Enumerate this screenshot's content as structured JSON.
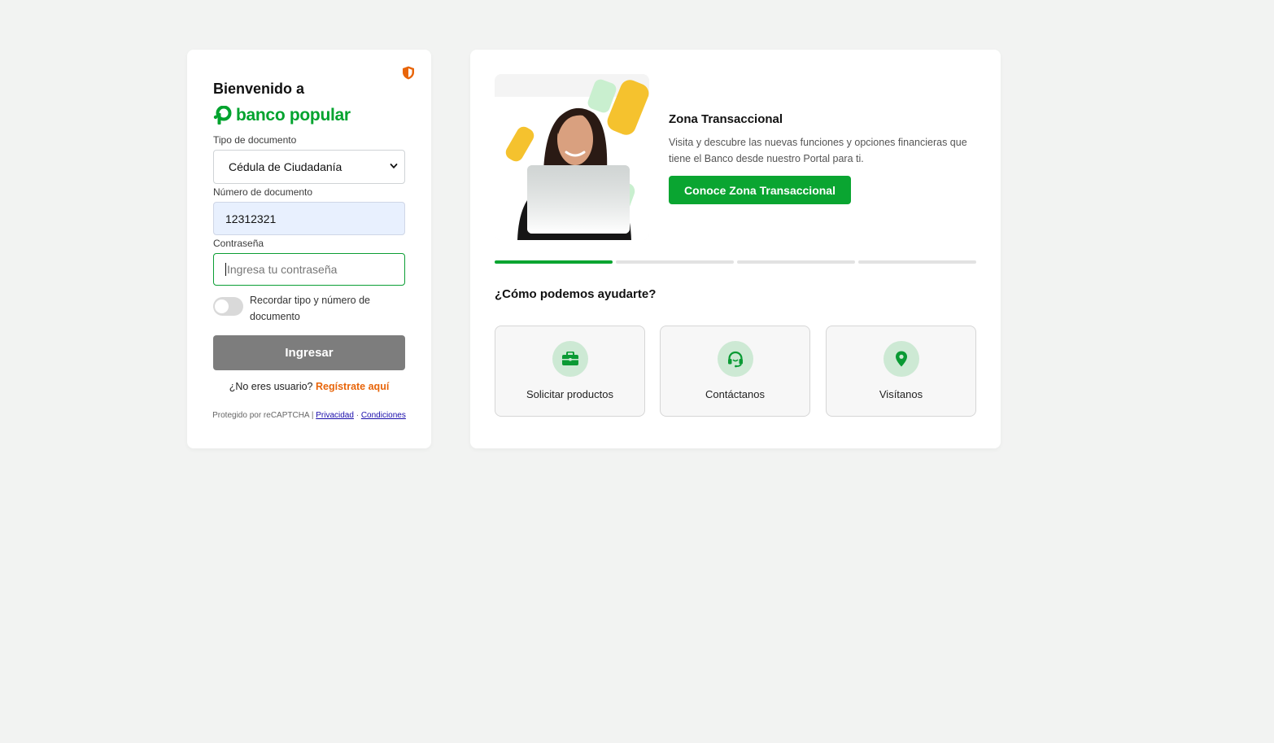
{
  "login": {
    "welcome": "Bienvenido a",
    "brand": "banco popular",
    "doc_type_label": "Tipo de documento",
    "doc_type_value": "Cédula de Ciudadanía",
    "doc_number_label": "Número de documento",
    "doc_number_value": "12312321",
    "password_label": "Contraseña",
    "password_placeholder": "Ingresa tu contraseña",
    "remember_label": "Recordar tipo y número de documento",
    "submit_label": "Ingresar",
    "register_prompt": "¿No eres usuario?",
    "register_link": "Regístrate aquí",
    "captcha_text": "Protegido por reCAPTCHA |",
    "privacy_link": "Privacidad",
    "separator": "·",
    "terms_link": "Condiciones"
  },
  "promo": {
    "title": "Zona Transaccional",
    "description": "Visita y descubre las nuevas funciones y opciones financieras que tiene el Banco desde nuestro Portal para ti.",
    "button_label": "Conoce Zona Transaccional",
    "slides_total": 4,
    "active_slide": 1
  },
  "help": {
    "title": "¿Cómo podemos ayudarte?",
    "tiles": [
      {
        "label": "Solicitar productos",
        "icon": "briefcase-icon"
      },
      {
        "label": "Contáctanos",
        "icon": "headset-icon"
      },
      {
        "label": "Visítanos",
        "icon": "location-pin-icon"
      }
    ]
  },
  "colors": {
    "brand_green": "#00a32e",
    "button_green": "#0aa531",
    "link_orange": "#e8650a",
    "disabled_button": "#7d7d7d",
    "background": "#f2f3f2"
  }
}
